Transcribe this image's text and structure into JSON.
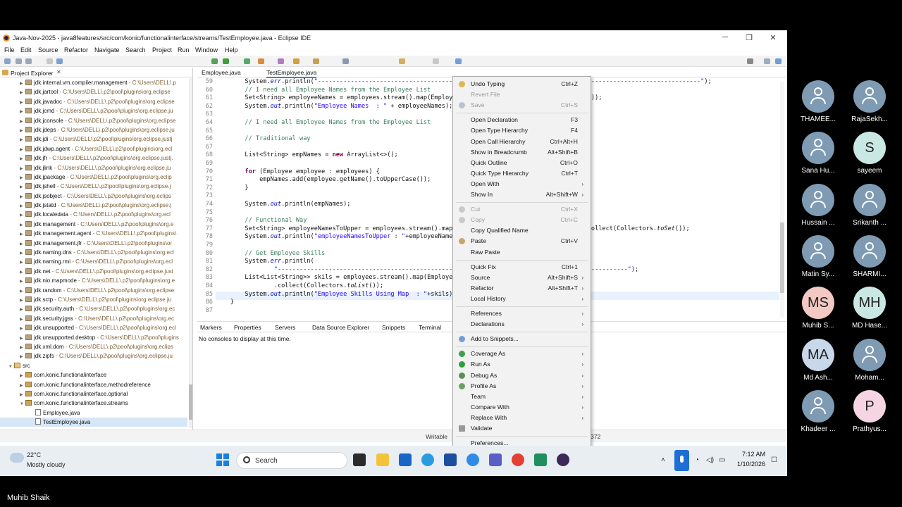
{
  "window": {
    "title": "Java-Nov-2025 - java8features/src/com/konic/functionalinterface/streams/TestEmployee.java - Eclipse IDE",
    "minimize": "─",
    "maximize": "❐",
    "close": "✕"
  },
  "menu": [
    "File",
    "Edit",
    "Source",
    "Refactor",
    "Navigate",
    "Search",
    "Project",
    "Run",
    "Window",
    "Help"
  ],
  "explorer": {
    "title": "Project Explorer",
    "items": [
      {
        "name": "jdk.internal.vm.compiler.management",
        "path": " - C:\\Users\\DELL\\.p"
      },
      {
        "name": "jdk.jartool",
        "path": " - C:\\Users\\DELL\\.p2\\pool\\plugins\\org.eclipse"
      },
      {
        "name": "jdk.javadoc",
        "path": " - C:\\Users\\DELL\\.p2\\pool\\plugins\\org.eclipse"
      },
      {
        "name": "jdk.jcmd",
        "path": " - C:\\Users\\DELL\\.p2\\pool\\plugins\\org.eclipse.ju"
      },
      {
        "name": "jdk.jconsole",
        "path": " - C:\\Users\\DELL\\.p2\\pool\\plugins\\org.eclipse"
      },
      {
        "name": "jdk.jdeps",
        "path": " - C:\\Users\\DELL\\.p2\\pool\\plugins\\org.eclipse.ju"
      },
      {
        "name": "jdk.jdi",
        "path": " - C:\\Users\\DELL\\.p2\\pool\\plugins\\org.eclipse.justj"
      },
      {
        "name": "jdk.jdwp.agent",
        "path": " - C:\\Users\\DELL\\.p2\\pool\\plugins\\org.ecl"
      },
      {
        "name": "jdk.jfr",
        "path": " - C:\\Users\\DELL\\.p2\\pool\\plugins\\org.eclipse.justj."
      },
      {
        "name": "jdk.jlink",
        "path": " - C:\\Users\\DELL\\.p2\\pool\\plugins\\org.eclipse.ju"
      },
      {
        "name": "jdk.jpackage",
        "path": " - C:\\Users\\DELL\\.p2\\pool\\plugins\\org.eclip"
      },
      {
        "name": "jdk.jshell",
        "path": " - C:\\Users\\DELL\\.p2\\pool\\plugins\\org.eclipse.j"
      },
      {
        "name": "jdk.jsobject",
        "path": " - C:\\Users\\DELL\\.p2\\pool\\plugins\\org.eclips"
      },
      {
        "name": "jdk.jstatd",
        "path": " - C:\\Users\\DELL\\.p2\\pool\\plugins\\org.eclipse.j"
      },
      {
        "name": "jdk.localedata",
        "path": " - C:\\Users\\DELL\\.p2\\pool\\plugins\\org.ecl"
      },
      {
        "name": "jdk.management",
        "path": " - C:\\Users\\DELL\\.p2\\pool\\plugins\\org.e"
      },
      {
        "name": "jdk.management.agent",
        "path": " - C:\\Users\\DELL\\.p2\\pool\\plugins\\"
      },
      {
        "name": "jdk.management.jfr",
        "path": " - C:\\Users\\DELL\\.p2\\pool\\plugins\\or"
      },
      {
        "name": "jdk.naming.dns",
        "path": " - C:\\Users\\DELL\\.p2\\pool\\plugins\\org.ecl"
      },
      {
        "name": "jdk.naming.rmi",
        "path": " - C:\\Users\\DELL\\.p2\\pool\\plugins\\org.ecl"
      },
      {
        "name": "jdk.net",
        "path": " - C:\\Users\\DELL\\.p2\\pool\\plugins\\org.eclipse.just"
      },
      {
        "name": "jdk.nio.mapmode",
        "path": " - C:\\Users\\DELL\\.p2\\pool\\plugins\\org.e"
      },
      {
        "name": "jdk.random",
        "path": " - C:\\Users\\DELL\\.p2\\pool\\plugins\\org.eclipse"
      },
      {
        "name": "jdk.sctp",
        "path": " - C:\\Users\\DELL\\.p2\\pool\\plugins\\org.eclipse.ju"
      },
      {
        "name": "jdk.security.auth",
        "path": " - C:\\Users\\DELL\\.p2\\pool\\plugins\\org.ec"
      },
      {
        "name": "jdk.security.jgss",
        "path": " - C:\\Users\\DELL\\.p2\\pool\\plugins\\org.ec"
      },
      {
        "name": "jdk.unsupported",
        "path": " - C:\\Users\\DELL\\.p2\\pool\\plugins\\org.ecl"
      },
      {
        "name": "jdk.unsupported.desktop",
        "path": " - C:\\Users\\DELL\\.p2\\pool\\plugins"
      },
      {
        "name": "jdk.xml.dom",
        "path": " - C:\\Users\\DELL\\.p2\\pool\\plugins\\org.eclips"
      },
      {
        "name": "jdk.zipfs",
        "path": " - C:\\Users\\DELL\\.p2\\pool\\plugins\\org.eclipse.ju"
      }
    ],
    "src": "src",
    "packages": [
      "com.konic.functionalinterface",
      "com.konic.functionalinterface.methodreference",
      "com.konic.functionalinterface.optional",
      "com.konic.functionalinterface.streams"
    ],
    "files": [
      "Employee.java",
      "TestEmployee.java"
    ]
  },
  "editor": {
    "tabs": [
      "Employee.java",
      "TestEmployee.java"
    ],
    "line_numbers": [
      "59",
      "60",
      "61",
      "62",
      "63",
      "64",
      "65",
      "66",
      "67",
      "68",
      "69",
      "70",
      "71",
      "72",
      "73",
      "74",
      "75",
      "76",
      "77",
      "78",
      "79",
      "80",
      "81",
      "82",
      "83",
      "84",
      "85",
      "86",
      "87"
    ]
  },
  "console": {
    "tabs": [
      "Markers",
      "Properties",
      "Servers",
      "Data Source Explorer",
      "Snippets",
      "Terminal"
    ],
    "message": "No consoles to display at this time."
  },
  "status": {
    "writable": "Writable",
    "position": "372"
  },
  "context_menu": [
    {
      "label": "Undo Typing",
      "shortcut": "Ctrl+Z",
      "icon": "undo-icon"
    },
    {
      "label": "Revert File",
      "disabled": true
    },
    {
      "label": "Save",
      "shortcut": "Ctrl+S",
      "disabled": true,
      "icon": "save-icon"
    },
    {
      "sep": true
    },
    {
      "label": "Open Declaration",
      "shortcut": "F3"
    },
    {
      "label": "Open Type Hierarchy",
      "shortcut": "F4"
    },
    {
      "label": "Open Call Hierarchy",
      "shortcut": "Ctrl+Alt+H"
    },
    {
      "label": "Show in Breadcrumb",
      "shortcut": "Alt+Shift+B"
    },
    {
      "label": "Quick Outline",
      "shortcut": "Ctrl+O"
    },
    {
      "label": "Quick Type Hierarchy",
      "shortcut": "Ctrl+T"
    },
    {
      "label": "Open With",
      "submenu": true
    },
    {
      "label": "Show In",
      "shortcut": "Alt+Shift+W",
      "submenu": true
    },
    {
      "sep": true
    },
    {
      "label": "Cut",
      "shortcut": "Ctrl+X",
      "disabled": true,
      "icon": "cut-icon"
    },
    {
      "label": "Copy",
      "shortcut": "Ctrl+C",
      "disabled": true,
      "icon": "copy-icon"
    },
    {
      "label": "Copy Qualified Name"
    },
    {
      "label": "Paste",
      "shortcut": "Ctrl+V",
      "icon": "paste-icon"
    },
    {
      "label": "Raw Paste"
    },
    {
      "sep": true
    },
    {
      "label": "Quick Fix",
      "shortcut": "Ctrl+1"
    },
    {
      "label": "Source",
      "shortcut": "Alt+Shift+S",
      "submenu": true
    },
    {
      "label": "Refactor",
      "shortcut": "Alt+Shift+T",
      "submenu": true
    },
    {
      "label": "Local History",
      "submenu": true
    },
    {
      "sep": true
    },
    {
      "label": "References",
      "submenu": true
    },
    {
      "label": "Declarations",
      "submenu": true
    },
    {
      "sep": true
    },
    {
      "label": "Add to Snippets...",
      "icon": "snippet-icon"
    },
    {
      "sep": true
    },
    {
      "label": "Coverage As",
      "submenu": true,
      "icon": "coverage-icon"
    },
    {
      "label": "Run As",
      "submenu": true,
      "icon": "run-icon"
    },
    {
      "label": "Debug As",
      "submenu": true,
      "icon": "debug-icon"
    },
    {
      "label": "Profile As",
      "submenu": true,
      "icon": "profile-icon"
    },
    {
      "label": "Team",
      "submenu": true
    },
    {
      "label": "Compare With",
      "submenu": true
    },
    {
      "label": "Replace With",
      "submenu": true
    },
    {
      "label": "Validate",
      "icon": "validate-icon"
    },
    {
      "sep": true
    },
    {
      "label": "Preferences..."
    }
  ],
  "taskbar": {
    "temp": "22°C",
    "condition": "Mostly cloudy",
    "search": "Search",
    "time": "7:12 AM",
    "date": "1/10/2026"
  },
  "participants": [
    {
      "name": "THAMEE...",
      "initials": "",
      "color": "#7f9bb3"
    },
    {
      "name": "RajaSekh...",
      "initials": "",
      "color": "#7f9bb3"
    },
    {
      "name": "Sana Hu...",
      "initials": "",
      "color": "#7f9bb3"
    },
    {
      "name": "sayeem",
      "initials": "S",
      "color": "#c9e8e3"
    },
    {
      "name": "Hussain ...",
      "initials": "",
      "color": "#7f9bb3"
    },
    {
      "name": "Srikanth ...",
      "initials": "",
      "color": "#7f9bb3"
    },
    {
      "name": "Matin Sy...",
      "initials": "",
      "color": "#7f9bb3"
    },
    {
      "name": "SHARMI...",
      "initials": "",
      "color": "#7f9bb3"
    },
    {
      "name": "Muhib S...",
      "initials": "MS",
      "color": "#f3c9c4"
    },
    {
      "name": "MD Hase...",
      "initials": "MH",
      "color": "#c9e8e3"
    },
    {
      "name": "Md Ash...",
      "initials": "MA",
      "color": "#c8d8ea"
    },
    {
      "name": "Moham...",
      "initials": "",
      "color": "#7f9bb3"
    },
    {
      "name": "Khadeer ...",
      "initials": "",
      "color": "#7f9bb3"
    },
    {
      "name": "Prathyus...",
      "initials": "P",
      "color": "#f5d5e2"
    }
  ],
  "presenter": "Muhib Shaik"
}
